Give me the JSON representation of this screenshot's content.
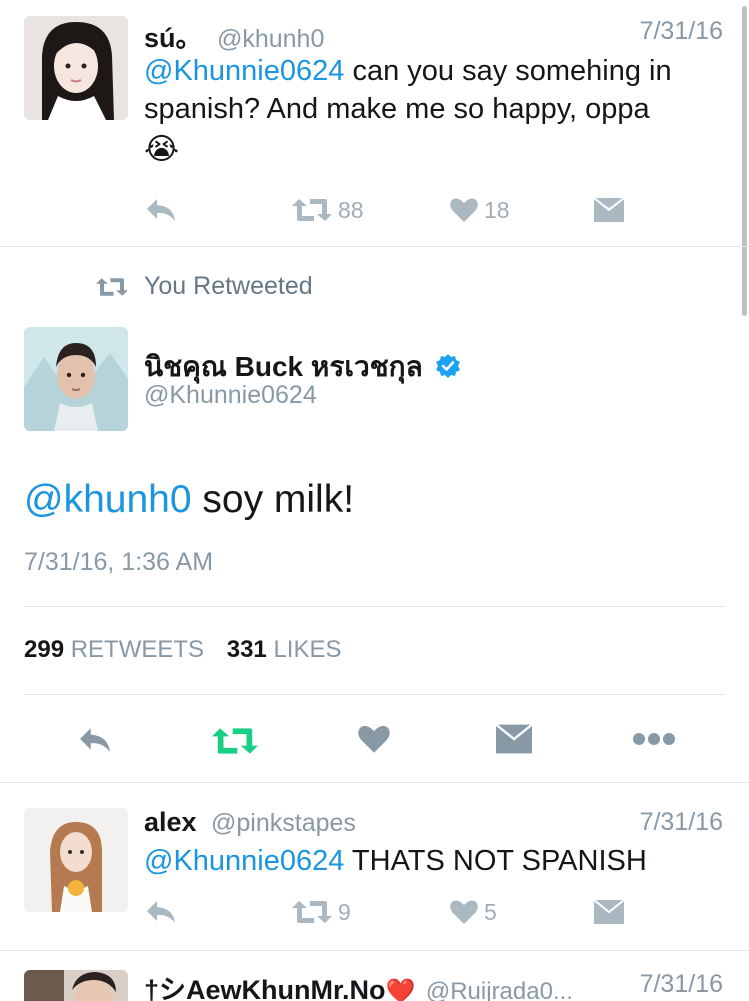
{
  "colors": {
    "link": "#1b95e0",
    "muted": "#8899a6",
    "icon": "#aab8c2",
    "retweet_active": "#19cf86",
    "verified": "#1da1f2"
  },
  "tweet1": {
    "name": "sú。",
    "handle": "@khunh0",
    "date": "7/31/16",
    "mention": "@Khunnie0624",
    "text_rest": " can you say somehing in spanish? And make me so happy, oppa",
    "emoji": "😭",
    "retweets": "88",
    "likes": "18"
  },
  "retweet_banner": {
    "label": "You Retweeted"
  },
  "main_tweet": {
    "name": "นิชคุณ Buck หรเวชกุล",
    "handle": "@Khunnie0624",
    "mention": "@khunh0",
    "text_rest": " soy milk!",
    "timestamp": "7/31/16, 1:36 AM",
    "retweets_count": "299",
    "retweets_label": "RETWEETS",
    "likes_count": "331",
    "likes_label": "LIKES"
  },
  "reply1": {
    "name": "alex",
    "handle": "@pinkstapes",
    "date": "7/31/16",
    "mention": "@Khunnie0624",
    "text_rest": " THATS NOT SPANISH",
    "retweets": "9",
    "likes": "5"
  },
  "reply2": {
    "name": "†シAewKhunMr.No",
    "heart_emoji": "❤️",
    "handle": "@Ruijrada0...",
    "date": "7/31/16"
  }
}
